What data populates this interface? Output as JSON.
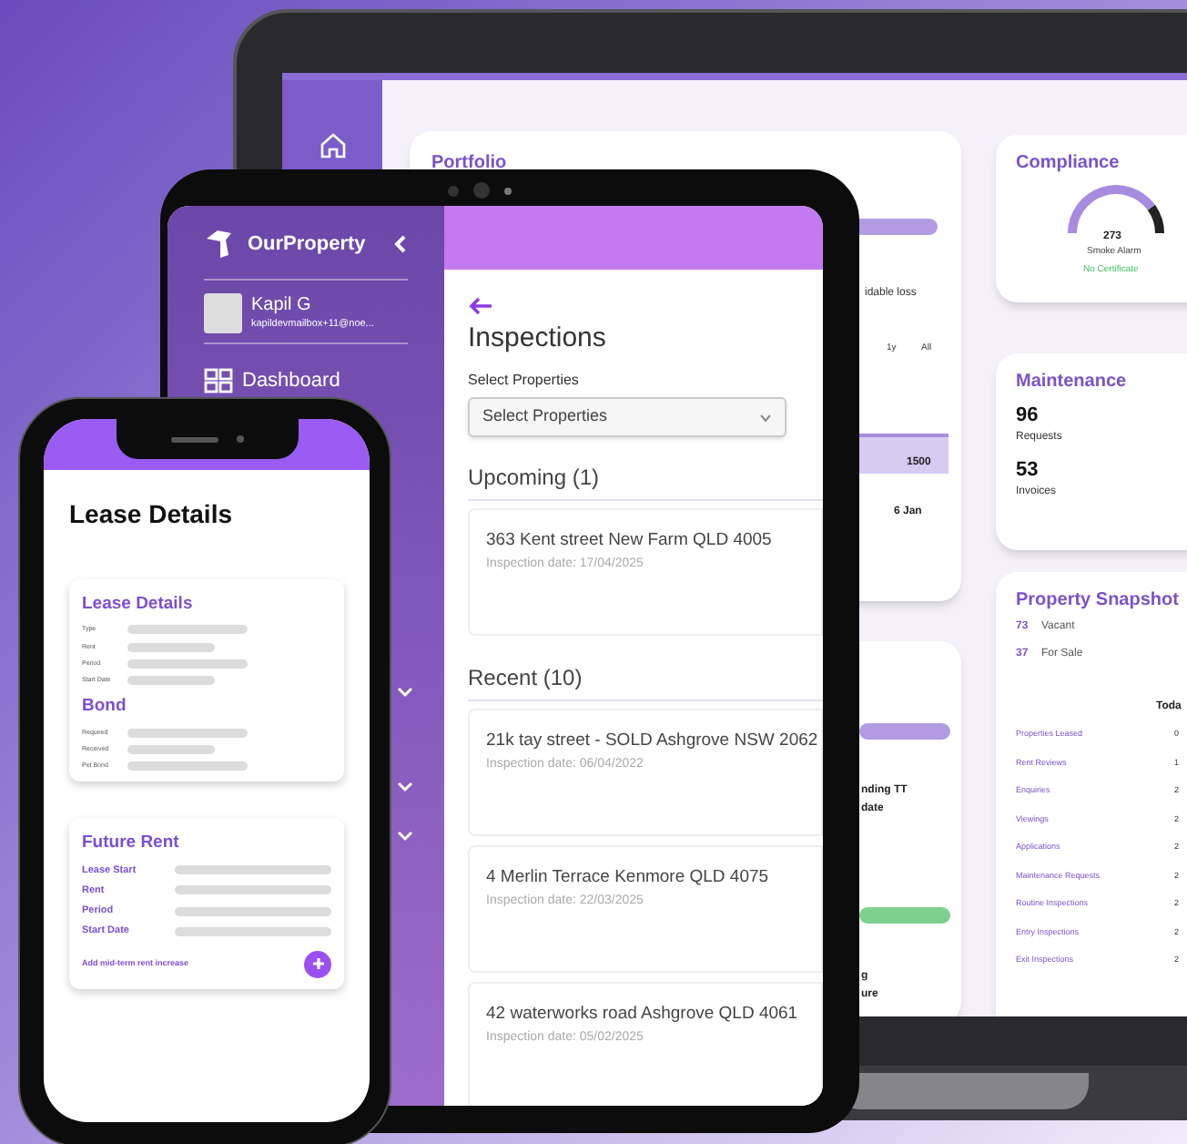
{
  "laptop": {
    "portfolio": {
      "title": "Portfolio",
      "fragments": [
        "idable loss",
        "1y",
        "All",
        "1500",
        "6 Jan"
      ]
    },
    "second_card": {
      "fragments": [
        "nding TT",
        "date",
        "g",
        "ure"
      ]
    },
    "compliance": {
      "title": "Compliance",
      "level": 0.8,
      "value": "273",
      "label": "Smoke Alarm",
      "status": "No Certificate"
    },
    "maintenance": {
      "title": "Maintenance",
      "stats": [
        {
          "value": "96",
          "label": "Requests"
        },
        {
          "value": "53",
          "label": "Invoices"
        }
      ]
    },
    "snapshot": {
      "title": "Property Snapshot",
      "counts": [
        {
          "value": "73",
          "label": "Vacant"
        },
        {
          "value": "37",
          "label": "For Sale"
        }
      ],
      "column": "Toda",
      "rows": [
        {
          "label": "Properties Leased",
          "value": "0"
        },
        {
          "label": "Rent Reviews",
          "value": "1"
        },
        {
          "label": "Enquiries",
          "value": "2"
        },
        {
          "label": "Viewings",
          "value": "2"
        },
        {
          "label": "Applications",
          "value": "2"
        },
        {
          "label": "Maintenance Requests",
          "value": "2"
        },
        {
          "label": "Routine Inspections",
          "value": "2"
        },
        {
          "label": "Entry Inspections",
          "value": "2"
        },
        {
          "label": "Exit Inspections",
          "value": "2"
        }
      ]
    }
  },
  "tablet": {
    "sidebar": {
      "brand": "OurProperty",
      "user": {
        "name": "Kapil G",
        "email": "kapildevmailbox+11@noe..."
      },
      "nav": [
        {
          "label": "Dashboard"
        }
      ]
    },
    "title": "Inspections",
    "filter": {
      "label": "Select Properties",
      "placeholder": "Select Properties"
    },
    "sections": [
      {
        "title": "Upcoming (1)",
        "items": [
          {
            "address": "363 Kent street New Farm QLD 4005",
            "date": "Inspection date: 17/04/2025"
          }
        ]
      },
      {
        "title": "Recent (10)",
        "items": [
          {
            "address": "21k tay street - SOLD Ashgrove NSW 2062",
            "date": "Inspection date: 06/04/2022"
          },
          {
            "address": "4 Merlin Terrace Kenmore QLD 4075",
            "date": "Inspection date: 22/03/2025"
          },
          {
            "address": "42 waterworks road Ashgrove QLD 4061",
            "date": "Inspection date: 05/02/2025"
          }
        ]
      }
    ]
  },
  "phone": {
    "title": "Lease Details",
    "cards": [
      {
        "kind": "compact",
        "sections": [
          {
            "title": "Lease Details",
            "fields": [
              "Type",
              "Rent",
              "Period",
              "Start Date"
            ]
          },
          {
            "title": "Bond",
            "fields": [
              "Required",
              "Received",
              "Pet Bond"
            ]
          }
        ]
      },
      {
        "kind": "bold",
        "sections": [
          {
            "title": "Future Rent",
            "fields": [
              "Lease Start",
              "Rent",
              "Period",
              "Start Date"
            ]
          }
        ],
        "action": "Add mid-term rent increase"
      }
    ]
  }
}
